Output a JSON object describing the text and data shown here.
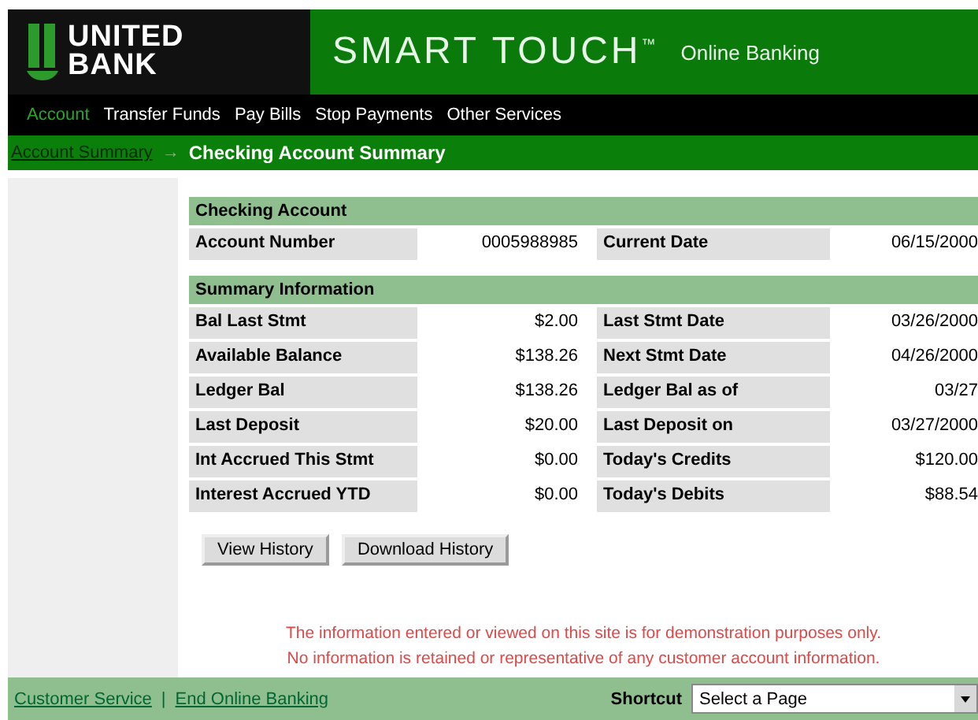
{
  "header": {
    "logo_text": [
      "UNITED",
      "BANK"
    ],
    "product": "SMART TOUCH$^{™}$",
    "tagline": "Online Banking"
  },
  "nav": [
    {
      "label": "Account",
      "selected": true
    },
    {
      "label": "Transfer Funds",
      "selected": false
    },
    {
      "label": "Pay Bills",
      "selected": false
    },
    {
      "label": "Stop Payments",
      "selected": false
    },
    {
      "label": "Other Services",
      "selected": false
    }
  ],
  "breadcrumb": {
    "link": "Account Summary",
    "separator": "→",
    "current": "Checking Account Summary"
  },
  "sections": [
    {
      "title": "Checking Account",
      "rows": [
        [
          "Account Number",
          "0005988985",
          "Current Date",
          "06/15/2000"
        ]
      ]
    },
    {
      "title": "Summary Information",
      "rows": [
        [
          "Bal Last Stmt",
          "$2.00",
          "Last Stmt Date",
          "03/26/2000"
        ],
        [
          "Available Balance",
          "$138.26",
          "Next Stmt Date",
          "04/26/2000"
        ],
        [
          "Ledger Bal",
          "$138.26",
          "Ledger Bal as of",
          "03/27"
        ],
        [
          "Last Deposit",
          "$20.00",
          "Last Deposit on",
          "03/27/2000"
        ],
        [
          "Int Accrued This Stmt",
          "$0.00",
          "Today's Credits",
          "$120.00"
        ],
        [
          "Interest Accrued YTD",
          "$0.00",
          "Today's Debits",
          "$88.54"
        ]
      ]
    }
  ],
  "buttons": [
    "View History",
    "Download History"
  ],
  "notice": [
    "The information entered or viewed on this site is for demonstration purposes only.",
    "No information is retained or representative of any customer account information."
  ],
  "footer": {
    "links": [
      "Customer Service",
      "End Online Banking"
    ],
    "separator": "|",
    "shortcut_label": "Shortcut",
    "shortcut_select": "Select a Page"
  }
}
